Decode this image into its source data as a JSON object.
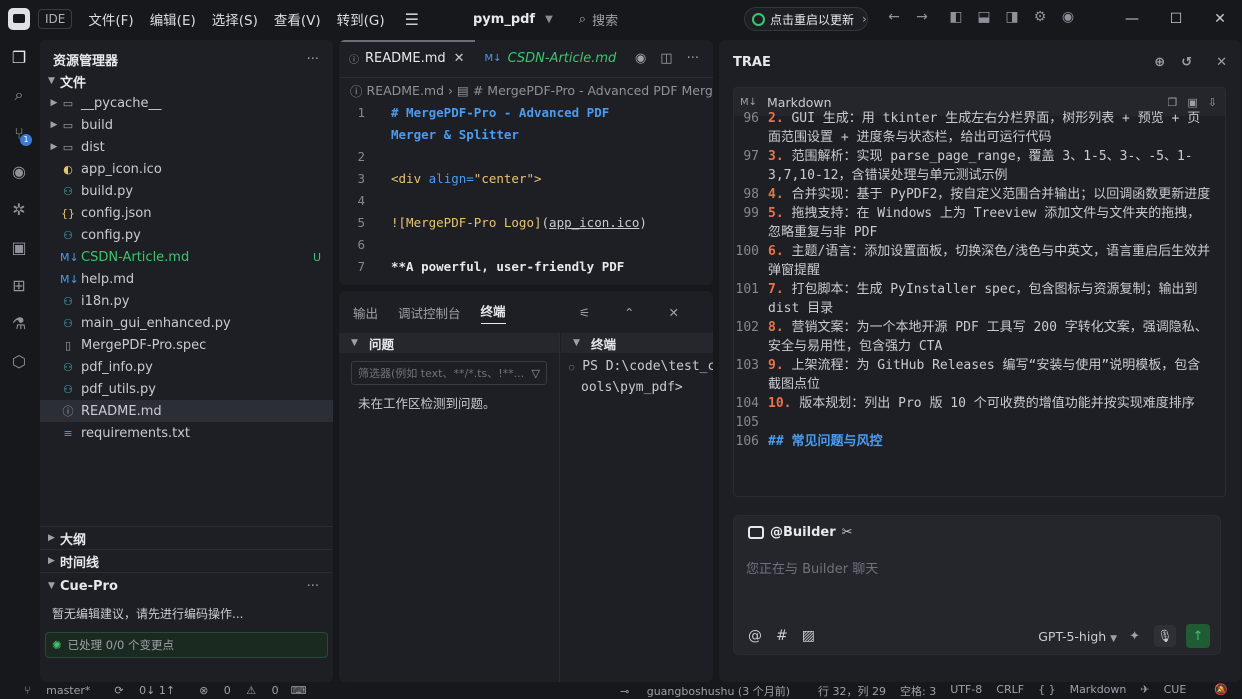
{
  "titlebar": {
    "ide": "IDE",
    "menu": [
      "文件(F)",
      "编辑(E)",
      "选择(S)",
      "查看(V)",
      "转到(G)"
    ],
    "project": "pym_pdf",
    "search": "搜索",
    "restart": "点击重启以更新"
  },
  "explorer": {
    "title": "资源管理器",
    "files_section": "文件",
    "items": [
      {
        "name": "__pycache__",
        "type": "folder"
      },
      {
        "name": "build",
        "type": "folder"
      },
      {
        "name": "dist",
        "type": "folder"
      },
      {
        "name": "app_icon.ico",
        "type": "file"
      },
      {
        "name": "build.py",
        "type": "file"
      },
      {
        "name": "config.json",
        "type": "file"
      },
      {
        "name": "config.py",
        "type": "file"
      },
      {
        "name": "CSDN-Article.md",
        "type": "file",
        "status": "U"
      },
      {
        "name": "help.md",
        "type": "file"
      },
      {
        "name": "i18n.py",
        "type": "file"
      },
      {
        "name": "main_gui_enhanced.py",
        "type": "file"
      },
      {
        "name": "MergePDF-Pro.spec",
        "type": "file"
      },
      {
        "name": "pdf_info.py",
        "type": "file"
      },
      {
        "name": "pdf_utils.py",
        "type": "file"
      },
      {
        "name": "README.md",
        "type": "file"
      },
      {
        "name": "requirements.txt",
        "type": "file"
      }
    ],
    "outline": "大纲",
    "timeline": "时间线",
    "cue_title": "Cue-Pro",
    "cue_text": "暂无编辑建议，请先进行编码操作...",
    "cue_status": "已处理 0/0 个变更点"
  },
  "editor": {
    "tabs": [
      {
        "label": "README.md",
        "active": true
      },
      {
        "label": "CSDN-Article.md",
        "active": false
      }
    ],
    "breadcrumb_file": "README.md",
    "breadcrumb_section": "# MergePDF-Pro - Advanced PDF Merger &",
    "line_numbers": [
      "1",
      "",
      "2",
      "3",
      "4",
      "5",
      "6",
      "7"
    ],
    "line1a": "# MergePDF-Pro - Advanced PDF",
    "line1b": "Merger & Splitter",
    "line3_tag": "<div",
    "line3_attr": "align=",
    "line3_val": "\"center\"",
    "line3_end": ">",
    "line5_a": "![MergePDF-Pro Logo]",
    "line5_b": "(",
    "line5_url": "app_icon.ico",
    "line5_c": ")",
    "line7": "**A powerful, user-friendly PDF"
  },
  "panel": {
    "tabs": [
      "输出",
      "调试控制台",
      "终端"
    ],
    "problems_title": "问题",
    "terminal_title": "终端",
    "filter_placeholder": "筛选器(例如 text、**/*.ts、!**...",
    "no_problems": "未在工作区检测到问题。",
    "terminal_lines": [
      "PS D:\\code\\test_c",
      "ools\\pym_pdf>"
    ]
  },
  "trae": {
    "title": "TRAE",
    "md_label": "Markdown",
    "lines": [
      {
        "n": "96",
        "num": "2.",
        "text": " GUI 生成：用 tkinter 生成左右分栏界面，树形列表 + 预览 + 页面范围设置 + 进度条与状态栏，给出可运行代码"
      },
      {
        "n": "97",
        "num": "3.",
        "text": " 范围解析：实现 parse_page_range，覆盖 3、1-5、3-、-5、1-3,7,10-12，含错误处理与单元测试示例"
      },
      {
        "n": "98",
        "num": "4.",
        "text": " 合并实现：基于 PyPDF2，按自定义范围合并输出；以回调函数更新进度"
      },
      {
        "n": "99",
        "num": "5.",
        "text": " 拖拽支持：在 Windows 上为 Treeview 添加文件与文件夹的拖拽，忽略重复与非 PDF"
      },
      {
        "n": "100",
        "num": "6.",
        "text": " 主题/语言：添加设置面板，切换深色/浅色与中英文，语言重启后生效并弹窗提醒"
      },
      {
        "n": "101",
        "num": "7.",
        "text": " 打包脚本：生成 PyInstaller spec，包含图标与资源复制；输出到 dist 目录"
      },
      {
        "n": "102",
        "num": "8.",
        "text": " 营销文案：为一个本地开源 PDF 工具写 200 字转化文案，强调隐私、安全与易用性，包含强力 CTA"
      },
      {
        "n": "103",
        "num": "9.",
        "text": " 上架流程：为 GitHub Releases 编写“安装与使用”说明模板，包含截图点位"
      },
      {
        "n": "104",
        "num": "10.",
        "text": " 版本规划：列出 Pro 版 10 个可收费的增值功能并按实现难度排序"
      },
      {
        "n": "105",
        "num": "",
        "text": ""
      },
      {
        "n": "106",
        "num": "",
        "text": "## 常见问题与风控"
      }
    ],
    "chat_agent": "@Builder",
    "chat_placeholder": "您正在与 Builder 聊天",
    "model": "GPT-5-high"
  },
  "status": {
    "branch": "master*",
    "sync": "0↓ 1↑",
    "errors": "0",
    "warnings": "0",
    "author": "guangboshushu (3 个月前)",
    "position": "行 32，列 29",
    "spaces": "空格: 3",
    "encoding": "UTF-8",
    "eol": "CRLF",
    "lang": "Markdown",
    "cue": "CUE"
  }
}
